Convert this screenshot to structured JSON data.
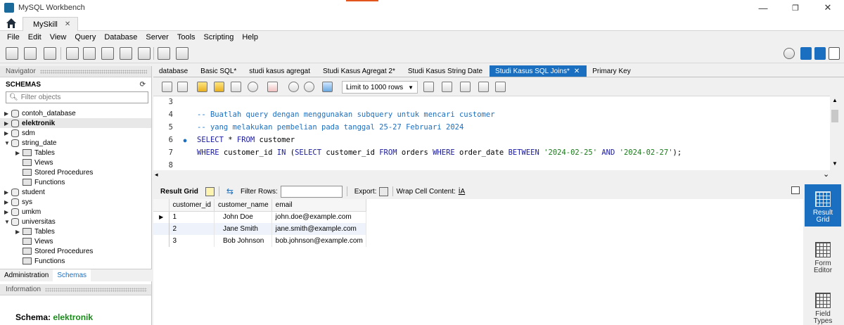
{
  "window": {
    "title": "MySQL Workbench",
    "minimize_glyph": "—",
    "restore_glyph": "❐",
    "close_glyph": "✕",
    "accent_color": "#e2561d"
  },
  "connection": {
    "tab_label": "MySkill",
    "close_glyph": "✕"
  },
  "menu": [
    "File",
    "Edit",
    "View",
    "Query",
    "Database",
    "Server",
    "Tools",
    "Scripting",
    "Help"
  ],
  "navigator": {
    "header": "Navigator",
    "schemas_label": "SCHEMAS",
    "filter_placeholder": "Filter objects",
    "tree": [
      {
        "label": "contoh_database",
        "type": "db",
        "level": 0,
        "expanded": false
      },
      {
        "label": "elektronik",
        "type": "db",
        "level": 0,
        "expanded": false,
        "selected": true,
        "bold": true
      },
      {
        "label": "sdm",
        "type": "db",
        "level": 0,
        "expanded": false
      },
      {
        "label": "string_date",
        "type": "db",
        "level": 0,
        "expanded": true
      },
      {
        "label": "Tables",
        "type": "folder",
        "level": 1,
        "expanded": false
      },
      {
        "label": "Views",
        "type": "folder",
        "level": 1
      },
      {
        "label": "Stored Procedures",
        "type": "folder",
        "level": 1
      },
      {
        "label": "Functions",
        "type": "folder",
        "level": 1
      },
      {
        "label": "student",
        "type": "db",
        "level": 0,
        "expanded": false
      },
      {
        "label": "sys",
        "type": "db",
        "level": 0,
        "expanded": false
      },
      {
        "label": "umkm",
        "type": "db",
        "level": 0,
        "expanded": false
      },
      {
        "label": "universitas",
        "type": "db",
        "level": 0,
        "expanded": true
      },
      {
        "label": "Tables",
        "type": "folder",
        "level": 1,
        "expanded": false
      },
      {
        "label": "Views",
        "type": "folder",
        "level": 1
      },
      {
        "label": "Stored Procedures",
        "type": "folder",
        "level": 1
      },
      {
        "label": "Functions",
        "type": "folder",
        "level": 1
      }
    ],
    "tabs": [
      "Administration",
      "Schemas"
    ],
    "active_tab": "Schemas"
  },
  "information": {
    "header": "Information",
    "schema_label": "Schema:",
    "schema_value": "elektronik"
  },
  "editor_tabs": [
    {
      "label": "database"
    },
    {
      "label": "Basic SQL*"
    },
    {
      "label": "studi kasus agregat"
    },
    {
      "label": "Studi Kasus Agregat 2*"
    },
    {
      "label": "Studi Kasus String Date"
    },
    {
      "label": "Studi Kasus SQL Joins*",
      "active": true,
      "close": "✕"
    },
    {
      "label": "Primary Key"
    }
  ],
  "sql_toolbar": {
    "limit_label": "Limit to 1000 rows"
  },
  "editor": {
    "lines": [
      {
        "num": "3",
        "marker": "",
        "parts": []
      },
      {
        "num": "4",
        "marker": "",
        "parts": [
          {
            "t": "-- Buatlah query dengan menggunakan subquery untuk mencari customer",
            "c": "cmt"
          }
        ]
      },
      {
        "num": "5",
        "marker": "",
        "parts": [
          {
            "t": "-- yang melakukan pembelian pada tanggal 25-27 Februari 2024",
            "c": "cmt"
          }
        ]
      },
      {
        "num": "6",
        "marker": "●",
        "parts": [
          {
            "t": "SELECT",
            "c": "kw"
          },
          {
            "t": " * ",
            "c": ""
          },
          {
            "t": "FROM",
            "c": "kw"
          },
          {
            "t": " customer",
            "c": ""
          }
        ]
      },
      {
        "num": "7",
        "marker": "",
        "parts": [
          {
            "t": "WHERE",
            "c": "kw"
          },
          {
            "t": " customer_id ",
            "c": ""
          },
          {
            "t": "IN",
            "c": "kw"
          },
          {
            "t": " (",
            "c": ""
          },
          {
            "t": "SELECT",
            "c": "kw"
          },
          {
            "t": " customer_id ",
            "c": ""
          },
          {
            "t": "FROM",
            "c": "kw"
          },
          {
            "t": " orders ",
            "c": ""
          },
          {
            "t": "WHERE",
            "c": "kw"
          },
          {
            "t": " order_date ",
            "c": ""
          },
          {
            "t": "BETWEEN",
            "c": "kw"
          },
          {
            "t": " ",
            "c": ""
          },
          {
            "t": "'2024-02-25'",
            "c": "str"
          },
          {
            "t": " ",
            "c": ""
          },
          {
            "t": "AND",
            "c": "kw"
          },
          {
            "t": " ",
            "c": ""
          },
          {
            "t": "'2024-02-27'",
            "c": "str"
          },
          {
            "t": ");",
            "c": ""
          }
        ]
      },
      {
        "num": "8",
        "marker": "",
        "parts": []
      }
    ]
  },
  "result_toolbar": {
    "result_grid": "Result Grid",
    "filter_rows": "Filter Rows:",
    "export": "Export:",
    "wrap_cell": "Wrap Cell Content:"
  },
  "result": {
    "columns": [
      "customer_id",
      "customer_name",
      "email"
    ],
    "rows": [
      [
        "1",
        "John Doe",
        "john.doe@example.com"
      ],
      [
        "2",
        "Jane Smith",
        "jane.smith@example.com"
      ],
      [
        "3",
        "Bob Johnson",
        "bob.johnson@example.com"
      ]
    ],
    "current_row_marker": "▶"
  },
  "side_panel": [
    {
      "label": "Result Grid",
      "active": true
    },
    {
      "label": "Form Editor",
      "active": false
    },
    {
      "label": "Field Types",
      "active": false
    }
  ],
  "colors": {
    "accent": "#1a6fc1",
    "comment": "#1a6fc1",
    "keyword": "#1a1a9e",
    "string": "#1a7a1a",
    "schema_value": "#1a8a1a"
  }
}
